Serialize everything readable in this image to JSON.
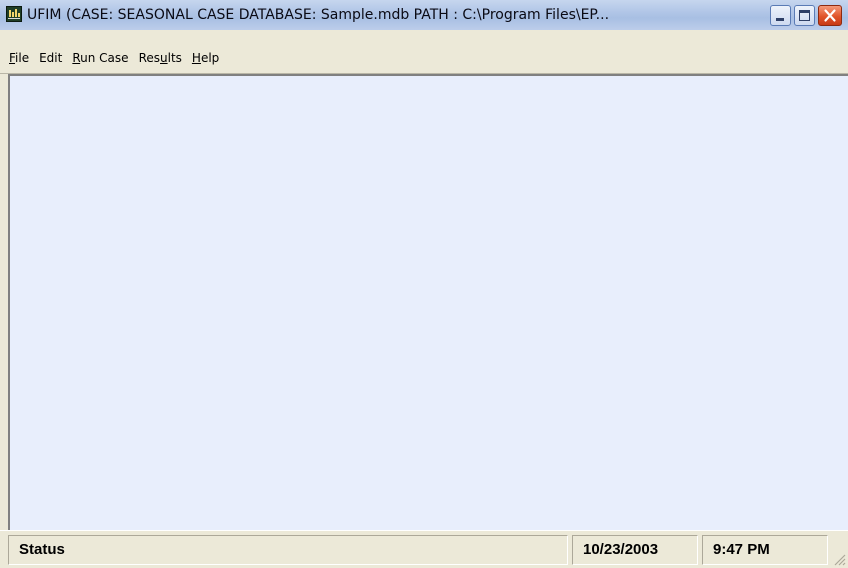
{
  "window": {
    "title": "UFIM (CASE: SEASONAL CASE   DATABASE: Sample.mdb   PATH : C:\\Program Files\\EP...",
    "icon": "app-chart-icon",
    "controls": {
      "minimize_icon": "minimize-icon",
      "maximize_icon": "maximize-icon",
      "close_icon": "close-icon",
      "close_color": "#e0552b"
    }
  },
  "menu": {
    "items": [
      {
        "label_ul": "F",
        "label_rest": "ile"
      },
      {
        "label_ul": "",
        "label_rest": "Edit"
      },
      {
        "label_ul": "R",
        "label_rest": "un Case"
      },
      {
        "label_pre": "Res",
        "label_ul": "u",
        "label_rest": "lts"
      },
      {
        "label_ul": "H",
        "label_rest": "elp"
      }
    ]
  },
  "client": {
    "background": "#e8eefc"
  },
  "statusbar": {
    "status_label": "Status",
    "date": "10/23/2003",
    "time": "9:47 PM"
  }
}
